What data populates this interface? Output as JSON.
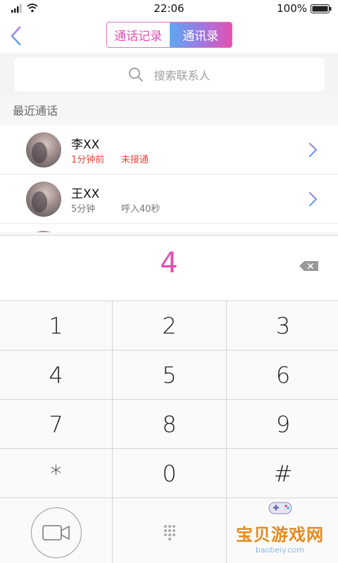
{
  "status_bar": {
    "time": "22:06",
    "battery": "100%"
  },
  "header": {
    "tabs": [
      {
        "label": "通话记录",
        "active": true
      },
      {
        "label": "通讯录",
        "active": false
      }
    ]
  },
  "search": {
    "placeholder": "搜索联系人"
  },
  "recent": {
    "title": "最近通话",
    "items": [
      {
        "name": "李XX",
        "time": "1分钟前",
        "status": "未接通"
      },
      {
        "name": "王XX",
        "time": "5分钟",
        "status": "呼入40秒"
      }
    ]
  },
  "dialer": {
    "entered": "4",
    "keys": [
      "1",
      "2",
      "3",
      "4",
      "5",
      "6",
      "7",
      "8",
      "9",
      "*",
      "0",
      "#"
    ]
  },
  "watermark": {
    "title": "宝贝游戏网",
    "url": "baobeiy.com"
  },
  "colors": {
    "accent_pink": "#e04fb3",
    "accent_blue": "#5aa8f0",
    "missed_red": "#e8473c"
  }
}
